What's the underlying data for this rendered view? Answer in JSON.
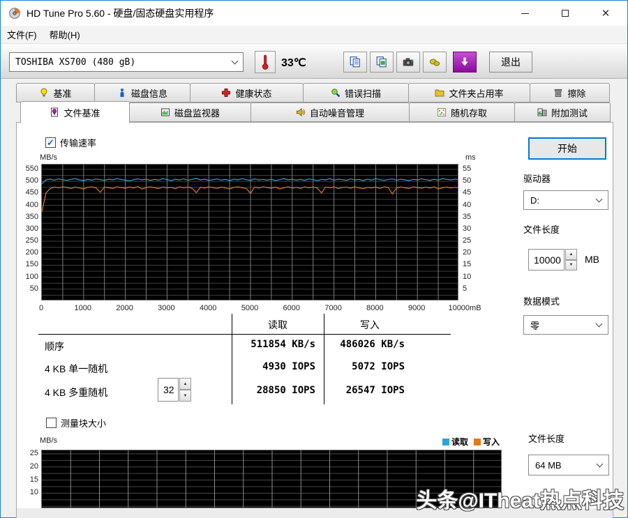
{
  "colors": {
    "accent": "#0078d7",
    "read": "#2ea3dc",
    "write": "#e07b1a",
    "chart_bg": "#000000"
  },
  "window": {
    "title": "HD Tune Pro 5.60 - 硬盘/固态硬盘实用程序"
  },
  "menu": {
    "file": "文件(F)",
    "help": "帮助(H)"
  },
  "toolbar": {
    "device": "TOSHIBA XS700 (480 gB)",
    "temperature": "33℃",
    "exit": "退出"
  },
  "tabs": {
    "row1": [
      {
        "label": "基准"
      },
      {
        "label": "磁盘信息"
      },
      {
        "label": "健康状态"
      },
      {
        "label": "错误扫描"
      },
      {
        "label": "文件夹占用率"
      },
      {
        "label": "擦除"
      }
    ],
    "row2": [
      {
        "label": "文件基准"
      },
      {
        "label": "磁盘监视器"
      },
      {
        "label": "自动噪音管理"
      },
      {
        "label": "随机存取"
      },
      {
        "label": "附加测试"
      }
    ]
  },
  "file_benchmark": {
    "transfer_rate": "传输速率",
    "start": "开始",
    "drive_label": "驱动器",
    "drive": "D:",
    "file_length_label": "文件长度",
    "file_length": "10000",
    "file_length_unit": "MB",
    "data_mode_label": "数据模式",
    "data_mode": "零",
    "block_size_label": "测量块大小",
    "block_unit": "MB/s",
    "legend_read": "读取",
    "legend_write": "写入",
    "file_length2_label": "文件长度",
    "file_length2": "64 MB"
  },
  "results": {
    "col_read": "读取",
    "col_write": "写入",
    "rows": [
      {
        "label": "顺序",
        "read": "511854 KB/s",
        "write": "486026 KB/s"
      },
      {
        "label": "4 KB 单一随机",
        "read": "4930 IOPS",
        "write": "5072 IOPS"
      },
      {
        "label": "4 KB 多重随机",
        "queue": "32",
        "read": "28850 IOPS",
        "write": "26547 IOPS"
      }
    ]
  },
  "watermark": "头条@ITheat热点科技",
  "chart_data": [
    {
      "id": "transfer",
      "type": "line",
      "title": "传输速率",
      "ylabel_left": "MB/s",
      "ylabel_right": "ms",
      "xlabel_unit": "mB",
      "xlim": [
        0,
        10000
      ],
      "ylim": [
        0,
        570
      ],
      "ylim_right": [
        0,
        57
      ],
      "grid": {
        "x_step": 500,
        "y_step": 25,
        "x_color": "#7d7d7d",
        "y_color": "#3f3f3f"
      },
      "yticks_left": [
        550,
        500,
        450,
        400,
        350,
        300,
        250,
        200,
        150,
        100,
        50
      ],
      "yticks_right": [
        55,
        50,
        45,
        40,
        35,
        30,
        25,
        20,
        15,
        10,
        5
      ],
      "xticks": [
        {
          "v": 0,
          "label": "0"
        },
        {
          "v": 1000,
          "label": "1000"
        },
        {
          "v": 2000,
          "label": "2000"
        },
        {
          "v": 3000,
          "label": "3000"
        },
        {
          "v": 4000,
          "label": "4000"
        },
        {
          "v": 5000,
          "label": "5000"
        },
        {
          "v": 6000,
          "label": "6000"
        },
        {
          "v": 7000,
          "label": "7000"
        },
        {
          "v": 8000,
          "label": "8000"
        },
        {
          "v": 9000,
          "label": "9000"
        },
        {
          "v": 10150,
          "label": "10000mB"
        }
      ],
      "series": [
        {
          "name": "读取",
          "unit": "MB/s",
          "color": "#2ea3dc",
          "x_step": 100,
          "values": [
            490,
            506,
            509,
            505,
            510,
            507,
            504,
            508,
            511,
            506,
            503,
            508,
            505,
            510,
            507,
            504,
            509,
            506,
            511,
            508,
            505,
            502,
            507,
            510,
            506,
            509,
            504,
            508,
            505,
            511,
            507,
            503,
            509,
            506,
            510,
            505,
            508,
            512,
            506,
            509,
            504,
            507,
            510,
            505,
            508,
            503,
            509,
            506,
            511,
            507,
            504,
            510,
            506,
            508,
            505,
            509,
            503,
            507,
            511,
            506,
            509,
            505,
            508,
            504,
            510,
            507,
            503,
            508,
            506,
            511,
            505,
            509,
            507,
            504,
            510,
            506,
            508,
            503,
            509,
            505,
            511,
            507,
            504,
            508,
            510,
            505,
            509,
            506,
            503,
            508,
            506,
            510,
            507,
            504,
            509,
            505,
            511,
            508,
            506,
            509,
            507
          ]
        },
        {
          "name": "写入",
          "unit": "MB/s",
          "color": "#e07b1a",
          "x_step": 100,
          "values": [
            372,
            452,
            470,
            476,
            473,
            477,
            474,
            470,
            476,
            472,
            468,
            475,
            477,
            472,
            454,
            476,
            473,
            470,
            477,
            474,
            471,
            476,
            472,
            478,
            468,
            474,
            477,
            473,
            470,
            476,
            472,
            475,
            469,
            477,
            473,
            476,
            471,
            453,
            475,
            472,
            477,
            474,
            470,
            476,
            472,
            468,
            475,
            477,
            473,
            470,
            450,
            476,
            472,
            477,
            474,
            471,
            476,
            468,
            473,
            477,
            472,
            475,
            470,
            477,
            473,
            476,
            472,
            452,
            476,
            473,
            477,
            470,
            474,
            476,
            471,
            477,
            473,
            469,
            475,
            472,
            476,
            470,
            477,
            474,
            448,
            472,
            476,
            473,
            470,
            477,
            474,
            471,
            476,
            472,
            477,
            468,
            473,
            476,
            472,
            475,
            473
          ]
        }
      ]
    },
    {
      "id": "block",
      "type": "line",
      "title": "测量块大小",
      "ylabel_left": "MB/s",
      "xlim": [
        0,
        16
      ],
      "ylim": [
        4,
        26.3
      ],
      "grid": {
        "x_step": 1,
        "y_step": 2.5,
        "x_color": "#8a8a8a",
        "y_color": "#474747"
      },
      "yticks_left": [
        25,
        20,
        15,
        10
      ],
      "xticks": [],
      "series": []
    }
  ]
}
